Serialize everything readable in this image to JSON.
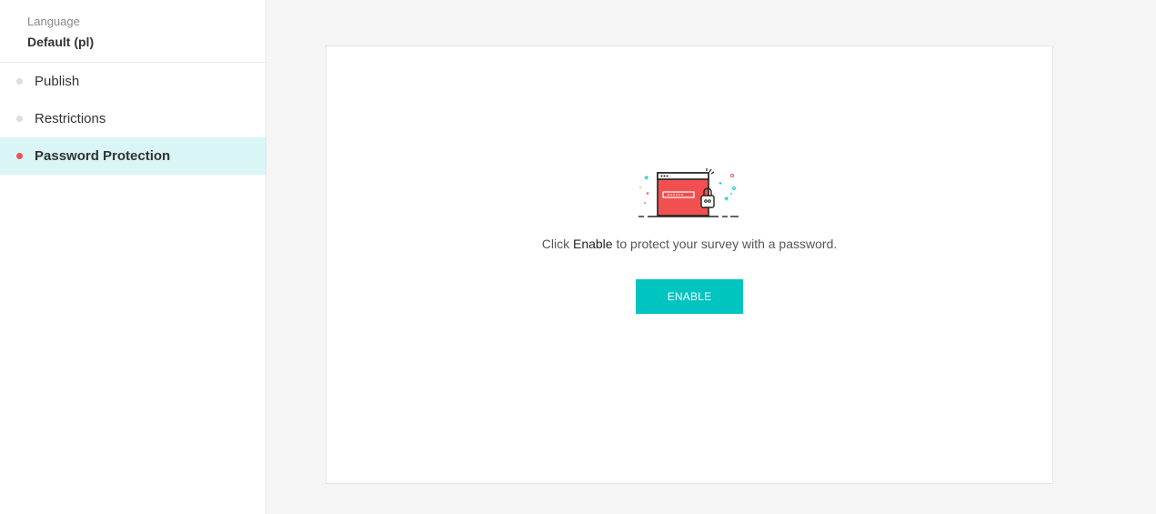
{
  "sidebar": {
    "language_label": "Language",
    "language_value": "Default (pl)",
    "items": [
      {
        "label": "Publish",
        "active": false
      },
      {
        "label": "Restrictions",
        "active": false
      },
      {
        "label": "Password Protection",
        "active": true
      }
    ]
  },
  "main": {
    "message_prefix": "Click ",
    "message_emphasis": "Enable",
    "message_suffix": " to protect your survey with a password.",
    "enable_button_label": "ENABLE",
    "illustration_icon": "password-lock-illustration"
  },
  "colors": {
    "accent_teal": "#00c4c0",
    "active_item_bg": "#d9f5f5",
    "active_dot": "#f25050",
    "illustration_red": "#f25050"
  }
}
